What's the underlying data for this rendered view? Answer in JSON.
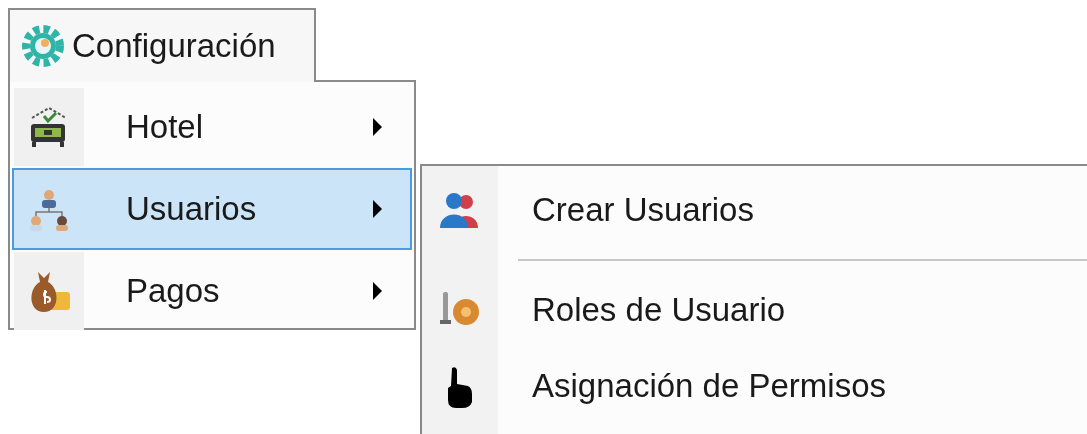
{
  "menu": {
    "title": "Configuración",
    "items": [
      {
        "label": "Hotel",
        "selected": false,
        "has_submenu": true
      },
      {
        "label": "Usuarios",
        "selected": true,
        "has_submenu": true
      },
      {
        "label": "Pagos",
        "selected": false,
        "has_submenu": true
      }
    ]
  },
  "submenu": {
    "items": [
      {
        "kind": "item",
        "label": "Crear Usuarios"
      },
      {
        "kind": "separator"
      },
      {
        "kind": "item",
        "label": "Roles de Usuario"
      },
      {
        "kind": "item",
        "label": "Asignación de Permisos"
      }
    ]
  }
}
